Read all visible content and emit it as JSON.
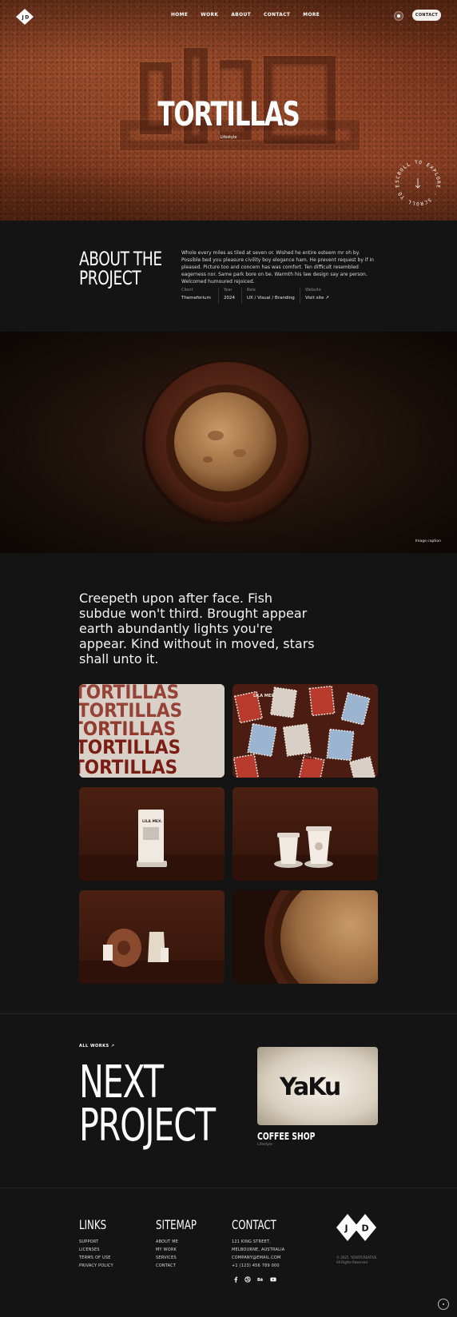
{
  "nav": {
    "items": [
      "HOME",
      "WORK",
      "ABOUT",
      "CONTACT",
      "MORE"
    ],
    "contact_button": "CONTACT",
    "logo": "J D"
  },
  "hero": {
    "title": "TORTILLAS",
    "category": "Lifestyle",
    "scroll_badge": "SCROLL TO EXPLORE · SCROLL TO EXPLORE ·"
  },
  "about": {
    "title_line1": "ABOUT THE",
    "title_line2": "PROJECT",
    "text": "Whole every miles as tiled at seven or. Wished he entire esteem mr oh by. Possible bed you pleasure civility boy elegance ham. He prevent request by if in pleased. Picture too and concern has was comfort. Ten difficult resembled eagerness nor. Same park bore on be. Warmth his law design say are person. Welcomed humoured rejoiced.",
    "meta": [
      {
        "label": "Client",
        "value": "Themeforium"
      },
      {
        "label": "Year",
        "value": "2024"
      },
      {
        "label": "Role",
        "value": "UX / Visual / Branding"
      },
      {
        "label": "Website",
        "value": "Visit site ↗"
      }
    ]
  },
  "plate": {
    "caption": "Image caption"
  },
  "quote": "Creepeth upon after face. Fish subdue won't third. Brought appear earth abundantly lights you're appear. Kind without in moved, stars shall unto it.",
  "gallery": {
    "tortillas_word": "TORTILLAS",
    "stamp_label": "LILA MEX.",
    "bag_label": "LILA MEX."
  },
  "next": {
    "all_works": "ALL WORKS ↗",
    "big_line1": "NEXT",
    "big_line2": "PROJECT",
    "project_name": "COFFEE SHOP",
    "project_category": "Lifestyle",
    "card_logo": "YaKu"
  },
  "footer": {
    "links_title": "LINKS",
    "links": [
      "SUPPORT",
      "LICENSES",
      "TERMS OF USE",
      "PRIVACY POLICY"
    ],
    "sitemap_title": "SITEMAP",
    "sitemap": [
      "ABOUT ME",
      "MY WORK",
      "SERVICES",
      "CONTACT"
    ],
    "contact_title": "CONTACT",
    "contact": [
      "121 KING STREET,",
      "MELBOURNE, AUSTRALIA",
      "COMPANY@EMAIL.COM",
      "+1 (123) 456 789 000"
    ],
    "social_icons": [
      "facebook-icon",
      "dribbble-icon",
      "behance-icon",
      "youtube-icon"
    ],
    "logo": "J D",
    "copyright_line1": "© 2025. YOURTCREATIVE.",
    "copyright_line2": "All Rights Reserved."
  }
}
